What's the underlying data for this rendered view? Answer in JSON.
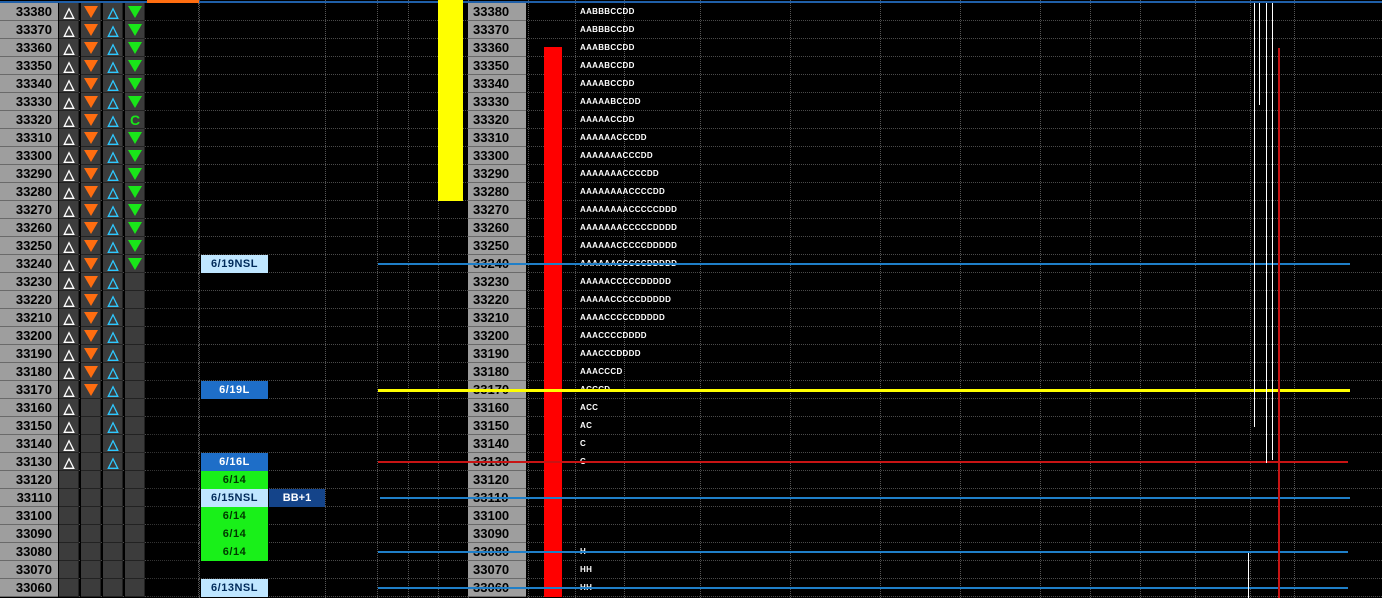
{
  "colors": {
    "price_bg": "#9e9e9e",
    "up_white": "#ffffff",
    "down_orange": "#ff6d10",
    "up_cyan": "#2ec8ff",
    "down_green": "#19e619",
    "bar_yellow": "#ffff00",
    "bar_red": "#ff0000",
    "line_blue": "#1f7fc8",
    "line_yellow": "#ffff00",
    "line_red": "#c81414"
  },
  "rows": [
    {
      "price": "33380",
      "c1": "tri-up-white",
      "c2": "tri-down-orange",
      "c3": "tri-up-cyan",
      "c4": "tri-down-green",
      "label": "",
      "tpo": "AABBBCCDD"
    },
    {
      "price": "33370",
      "c1": "tri-up-white",
      "c2": "tri-down-orange",
      "c3": "tri-up-cyan",
      "c4": "tri-down-green",
      "label": "",
      "tpo": "AABBBCCDD"
    },
    {
      "price": "33360",
      "c1": "tri-up-white",
      "c2": "tri-down-orange",
      "c3": "tri-up-cyan",
      "c4": "tri-down-green",
      "label": "",
      "tpo": "AAABBCCDD"
    },
    {
      "price": "33350",
      "c1": "tri-up-white",
      "c2": "tri-down-orange",
      "c3": "tri-up-cyan",
      "c4": "tri-down-green",
      "label": "",
      "tpo": "AAAABCCDD"
    },
    {
      "price": "33340",
      "c1": "tri-up-white",
      "c2": "tri-down-orange",
      "c3": "tri-up-cyan",
      "c4": "tri-down-green",
      "label": "",
      "tpo": "AAAABCCDD"
    },
    {
      "price": "33330",
      "c1": "tri-up-white",
      "c2": "tri-down-orange",
      "c3": "tri-up-cyan",
      "c4": "tri-down-green",
      "label": "",
      "tpo": "AAAAABCCDD"
    },
    {
      "price": "33320",
      "c1": "tri-up-white",
      "c2": "tri-down-orange",
      "c3": "tri-up-cyan",
      "c4": "letter-c",
      "label": "",
      "tpo": "AAAAACCDD"
    },
    {
      "price": "33310",
      "c1": "tri-up-white",
      "c2": "tri-down-orange",
      "c3": "tri-up-cyan",
      "c4": "tri-down-green",
      "label": "",
      "tpo": "AAAAAACCCDD"
    },
    {
      "price": "33300",
      "c1": "tri-up-white",
      "c2": "tri-down-orange",
      "c3": "tri-up-cyan",
      "c4": "tri-down-green",
      "label": "",
      "tpo": "AAAAAAACCCDD"
    },
    {
      "price": "33290",
      "c1": "tri-up-white",
      "c2": "tri-down-orange",
      "c3": "tri-up-cyan",
      "c4": "tri-down-green",
      "label": "",
      "tpo": "AAAAAAACCCCDD"
    },
    {
      "price": "33280",
      "c1": "tri-up-white",
      "c2": "tri-down-orange",
      "c3": "tri-up-cyan",
      "c4": "tri-down-green",
      "label": "",
      "tpo": "AAAAAAAACCCCDD"
    },
    {
      "price": "33270",
      "c1": "tri-up-white",
      "c2": "tri-down-orange",
      "c3": "tri-up-cyan",
      "c4": "tri-down-green",
      "label": "",
      "tpo": "AAAAAAAACCCCCDDD"
    },
    {
      "price": "33260",
      "c1": "tri-up-white",
      "c2": "tri-down-orange",
      "c3": "tri-up-cyan",
      "c4": "tri-down-green",
      "label": "",
      "tpo": "AAAAAAACCCCCDDDD"
    },
    {
      "price": "33250",
      "c1": "tri-up-white",
      "c2": "tri-down-orange",
      "c3": "tri-up-cyan",
      "c4": "tri-down-green",
      "label": "",
      "tpo": "AAAAAACCCCCDDDDD"
    },
    {
      "price": "33240",
      "c1": "tri-up-white",
      "c2": "tri-down-orange",
      "c3": "tri-up-cyan",
      "c4": "tri-down-green",
      "label": "6/19NSL",
      "label_style": "light",
      "tpo": "AAAAAACCCCCDDDDD"
    },
    {
      "price": "33230",
      "c1": "tri-up-white",
      "c2": "tri-down-orange",
      "c3": "tri-up-cyan",
      "c4": "",
      "label": "",
      "tpo": "AAAAACCCCCDDDDD"
    },
    {
      "price": "33220",
      "c1": "tri-up-white",
      "c2": "tri-down-orange",
      "c3": "tri-up-cyan",
      "c4": "",
      "label": "",
      "tpo": "AAAAACCCCCDDDDD"
    },
    {
      "price": "33210",
      "c1": "tri-up-white",
      "c2": "tri-down-orange",
      "c3": "tri-up-cyan",
      "c4": "",
      "label": "",
      "tpo": "AAAACCCCCDDDDD"
    },
    {
      "price": "33200",
      "c1": "tri-up-white",
      "c2": "tri-down-orange",
      "c3": "tri-up-cyan",
      "c4": "",
      "label": "",
      "tpo": "AAACCCCDDDD"
    },
    {
      "price": "33190",
      "c1": "tri-up-white",
      "c2": "tri-down-orange",
      "c3": "tri-up-cyan",
      "c4": "",
      "label": "",
      "tpo": "AAACCCDDDD"
    },
    {
      "price": "33180",
      "c1": "tri-up-white",
      "c2": "tri-down-orange",
      "c3": "tri-up-cyan",
      "c4": "",
      "label": "",
      "tpo": "AAACCCD"
    },
    {
      "price": "33170",
      "c1": "tri-up-white",
      "c2": "tri-down-orange",
      "c3": "tri-up-cyan",
      "c4": "",
      "label": "6/19L",
      "label_style": "blue",
      "tpo": "ACCCD"
    },
    {
      "price": "33160",
      "c1": "tri-up-white",
      "c2": "",
      "c3": "tri-up-cyan",
      "c4": "",
      "label": "",
      "tpo": "ACC"
    },
    {
      "price": "33150",
      "c1": "tri-up-white",
      "c2": "",
      "c3": "tri-up-cyan",
      "c4": "",
      "label": "",
      "tpo": "AC"
    },
    {
      "price": "33140",
      "c1": "tri-up-white",
      "c2": "",
      "c3": "tri-up-cyan",
      "c4": "",
      "label": "",
      "tpo": "C"
    },
    {
      "price": "33130",
      "c1": "tri-up-white",
      "c2": "",
      "c3": "tri-up-cyan",
      "c4": "",
      "label": "6/16L",
      "label_style": "blue",
      "tpo": "C"
    },
    {
      "price": "33120",
      "c1": "",
      "c2": "",
      "c3": "",
      "c4": "",
      "label": "6/14",
      "label_style": "green",
      "tpo": ""
    },
    {
      "price": "33110",
      "c1": "",
      "c2": "",
      "c3": "",
      "c4": "",
      "label": "6/15NSL",
      "label_style": "light",
      "tag": "BB+1",
      "tpo": ""
    },
    {
      "price": "33100",
      "c1": "",
      "c2": "",
      "c3": "",
      "c4": "",
      "label": "6/14",
      "label_style": "green",
      "tpo": ""
    },
    {
      "price": "33090",
      "c1": "",
      "c2": "",
      "c3": "",
      "c4": "",
      "label": "6/14",
      "label_style": "green",
      "tpo": ""
    },
    {
      "price": "33080",
      "c1": "",
      "c2": "",
      "c3": "",
      "c4": "",
      "label": "6/14",
      "label_style": "green",
      "tpo": "H"
    },
    {
      "price": "33070",
      "c1": "",
      "c2": "",
      "c3": "",
      "c4": "",
      "label": "",
      "tpo": "HH"
    },
    {
      "price": "33060",
      "c1": "",
      "c2": "",
      "c3": "",
      "c4": "",
      "label": "6/13NSL",
      "label_style": "light",
      "tpo": "HH"
    }
  ],
  "levels": [
    {
      "price": "33240",
      "color": "#1f7fc8"
    },
    {
      "price": "33170",
      "color": "#ffff00"
    },
    {
      "price": "33130",
      "color": "#c81414"
    },
    {
      "price": "33110",
      "color": "#1f7fc8"
    },
    {
      "price": "33080",
      "color": "#1f7fc8"
    },
    {
      "price": "33060",
      "color": "#1f7fc8"
    }
  ],
  "bars": [
    {
      "name": "yellow-bar",
      "color": "#ffff00",
      "from_price": "33380",
      "to_price": "33280"
    },
    {
      "name": "red-bar",
      "color": "#ff0000",
      "from_price": "33360",
      "to_price": "33060"
    }
  ]
}
